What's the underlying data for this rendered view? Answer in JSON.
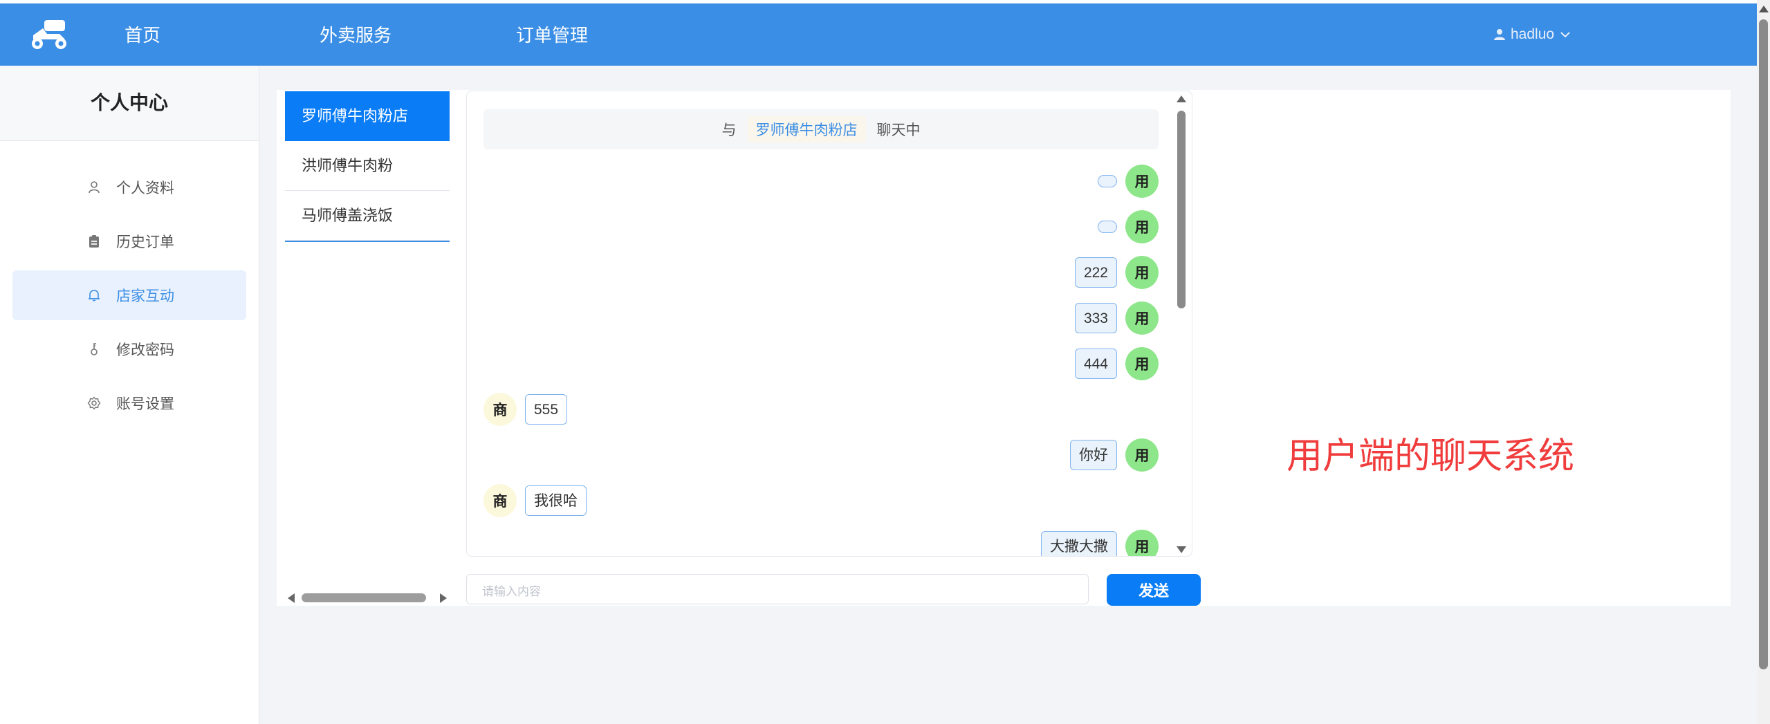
{
  "navbar": {
    "items": [
      "首页",
      "外卖服务",
      "订单管理"
    ],
    "username": "hadluo"
  },
  "sidebar": {
    "title": "个人中心",
    "items": [
      {
        "label": "个人资料",
        "icon": "user-icon"
      },
      {
        "label": "历史订单",
        "icon": "clipboard-icon"
      },
      {
        "label": "店家互动",
        "icon": "bell-icon",
        "active": true
      },
      {
        "label": "修改密码",
        "icon": "key-icon"
      },
      {
        "label": "账号设置",
        "icon": "gear-icon"
      }
    ]
  },
  "shops": {
    "items": [
      "罗师傅牛肉粉店",
      "洪师傅牛肉粉",
      "马师傅盖浇饭"
    ],
    "active_index": 0
  },
  "chat": {
    "header_prefix": "与",
    "header_shop": "罗师傅牛肉粉店",
    "header_suffix": "聊天中",
    "user_avatar_text": "用",
    "shop_avatar_text": "商",
    "messages": [
      {
        "from": "user",
        "text": ""
      },
      {
        "from": "user",
        "text": ""
      },
      {
        "from": "user",
        "text": "222"
      },
      {
        "from": "user",
        "text": "333"
      },
      {
        "from": "user",
        "text": "444"
      },
      {
        "from": "shop",
        "text": "555"
      },
      {
        "from": "user",
        "text": "你好"
      },
      {
        "from": "shop",
        "text": "我很哈"
      },
      {
        "from": "user",
        "text": "大撒大撒"
      }
    ]
  },
  "input": {
    "placeholder": "请输入内容",
    "send_label": "发送"
  },
  "annotation": "用户端的聊天系统",
  "colors": {
    "navbar": "#3b8ee5",
    "primary": "#0a7cf5",
    "user_avatar": "#8ee68a",
    "shop_avatar": "#fcf8dc",
    "annotation": "#f03c3c"
  }
}
